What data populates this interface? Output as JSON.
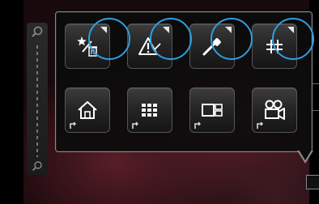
{
  "viewfinder": {
    "icon": "photo-background"
  },
  "zoom": {
    "in_icon": "magnifier-plus-icon",
    "out_icon": "magnifier-minus-icon"
  },
  "menu": {
    "top_row": [
      {
        "name": "favorites-delete",
        "icon": "star-trash-icon",
        "has_submenu": true,
        "highlighted": true
      },
      {
        "name": "warning",
        "icon": "warning-triangle-icon",
        "has_submenu": true,
        "highlighted": true
      },
      {
        "name": "eyedropper",
        "icon": "eyedropper-icon",
        "has_submenu": true,
        "highlighted": true
      },
      {
        "name": "grid",
        "icon": "grid-lines-icon",
        "has_submenu": true,
        "highlighted": true
      }
    ],
    "bottom_row": [
      {
        "name": "home",
        "icon": "home-icon"
      },
      {
        "name": "thumbnail-grid",
        "icon": "thumbnail-grid-icon"
      },
      {
        "name": "split-view",
        "icon": "split-view-icon"
      },
      {
        "name": "video-camera",
        "icon": "video-camera-icon"
      }
    ]
  },
  "colors": {
    "highlight": "#2ca0e0",
    "panel_border": "#8a8a8a"
  }
}
